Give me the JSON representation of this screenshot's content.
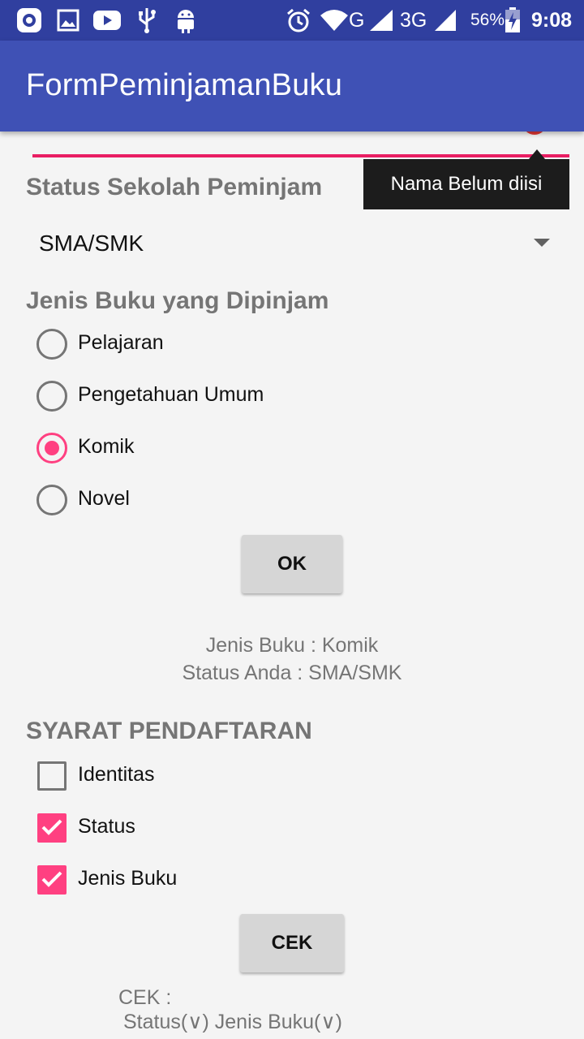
{
  "status_bar": {
    "icons": [
      "screen-record-icon",
      "image-icon",
      "youtube-icon",
      "usb-icon",
      "android-icon",
      "alarm-icon",
      "wifi-icon",
      "signal-icon",
      "signal-3g-icon",
      "battery-icon"
    ],
    "network_g": "G",
    "network_3g": "3G",
    "battery": "56%",
    "time": "9:08"
  },
  "app_bar": {
    "title": "FormPeminjamanBuku"
  },
  "name_field": {
    "error_tooltip": "Nama Belum diisi"
  },
  "school_status": {
    "label": "Status Sekolah Peminjam",
    "selected": "SMA/SMK"
  },
  "book_type": {
    "label": "Jenis Buku yang Dipinjam",
    "options": [
      {
        "label": "Pelajaran",
        "checked": false
      },
      {
        "label": "Pengetahuan Umum",
        "checked": false
      },
      {
        "label": "Komik",
        "checked": true
      },
      {
        "label": "Novel",
        "checked": false
      }
    ],
    "ok_button": "OK"
  },
  "result": {
    "line1": "Jenis Buku : Komik",
    "line2": "Status Anda : SMA/SMK"
  },
  "requirements": {
    "label": "SYARAT PENDAFTARAN",
    "items": [
      {
        "label": "Identitas",
        "checked": false
      },
      {
        "label": "Status",
        "checked": true
      },
      {
        "label": "Jenis Buku",
        "checked": true
      }
    ],
    "cek_button": "CEK"
  },
  "cek_result": {
    "line1": "CEK :",
    "line2": "Status(∨) Jenis Buku(∨)"
  },
  "colors": {
    "status_bar": "#303f9f",
    "app_bar": "#3f51b5",
    "accent": "#ff4081",
    "error_line": "#e91e63",
    "background": "#f4f4f4"
  }
}
